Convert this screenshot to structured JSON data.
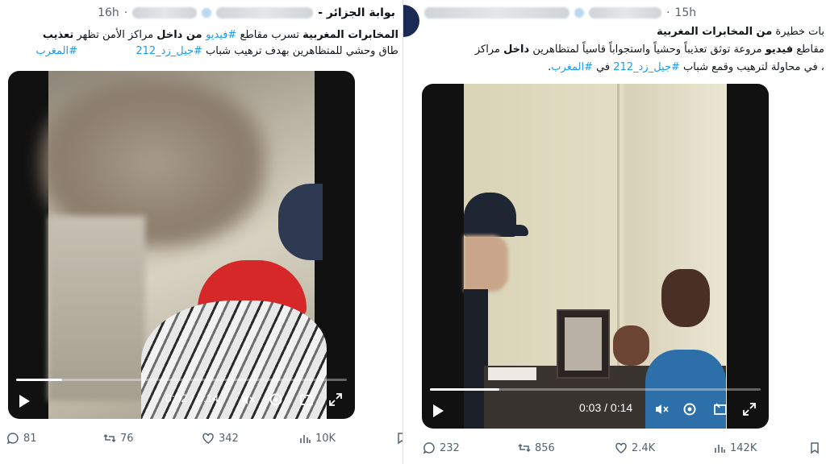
{
  "left": {
    "header": {
      "name": "بوابة الجزائر -",
      "time": "16h"
    },
    "text": {
      "line1_a": "المخابرات المغربية",
      "line1_b": " تسرب مقاطع ",
      "line1_c": "#فيديو",
      "line1_d": " من داخل",
      "line1_e": " مراكز الأمن تظهر ",
      "line1_f": "تعذيب",
      "line2": "طاق وحشي للمتظاهرين  بهدف ترهيب  شباب ",
      "line2_tag": "#جيل_زد_212",
      "line3_tag": "#المغرب"
    },
    "video": {
      "time": "0:02 / 0:14",
      "progress": 0.14
    },
    "stats": {
      "replies": "81",
      "reposts": "76",
      "likes": "342",
      "views": "10K"
    }
  },
  "right": {
    "header": {
      "time": "15h"
    },
    "text": {
      "line1_a": "بات خطيرة ",
      "line1_b": "من المخابرات المغربية",
      "line2_a": "مقاطع ",
      "line2_b": "فيديو",
      "line2_c": " مروعة توثق تعذيباً وحشياً واستجواباً قاسياً لمتظاهرين ",
      "line2_d": "داخل",
      "line2_e": " مراكز",
      "line3_a": "، في محاولة لترهيب وقمع شباب ",
      "line3_tag1": "#جيل_زد_212",
      "line3_b": " في ",
      "line3_tag2": "#المغرب",
      "line3_c": "."
    },
    "video": {
      "time": "0:03 / 0:14",
      "progress": 0.21
    },
    "stats": {
      "replies": "232",
      "reposts": "856",
      "likes": "2.4K",
      "views": "142K"
    }
  },
  "colors": {
    "link": "#1d9bf0",
    "text": "#0f1419",
    "muted": "#536471"
  }
}
